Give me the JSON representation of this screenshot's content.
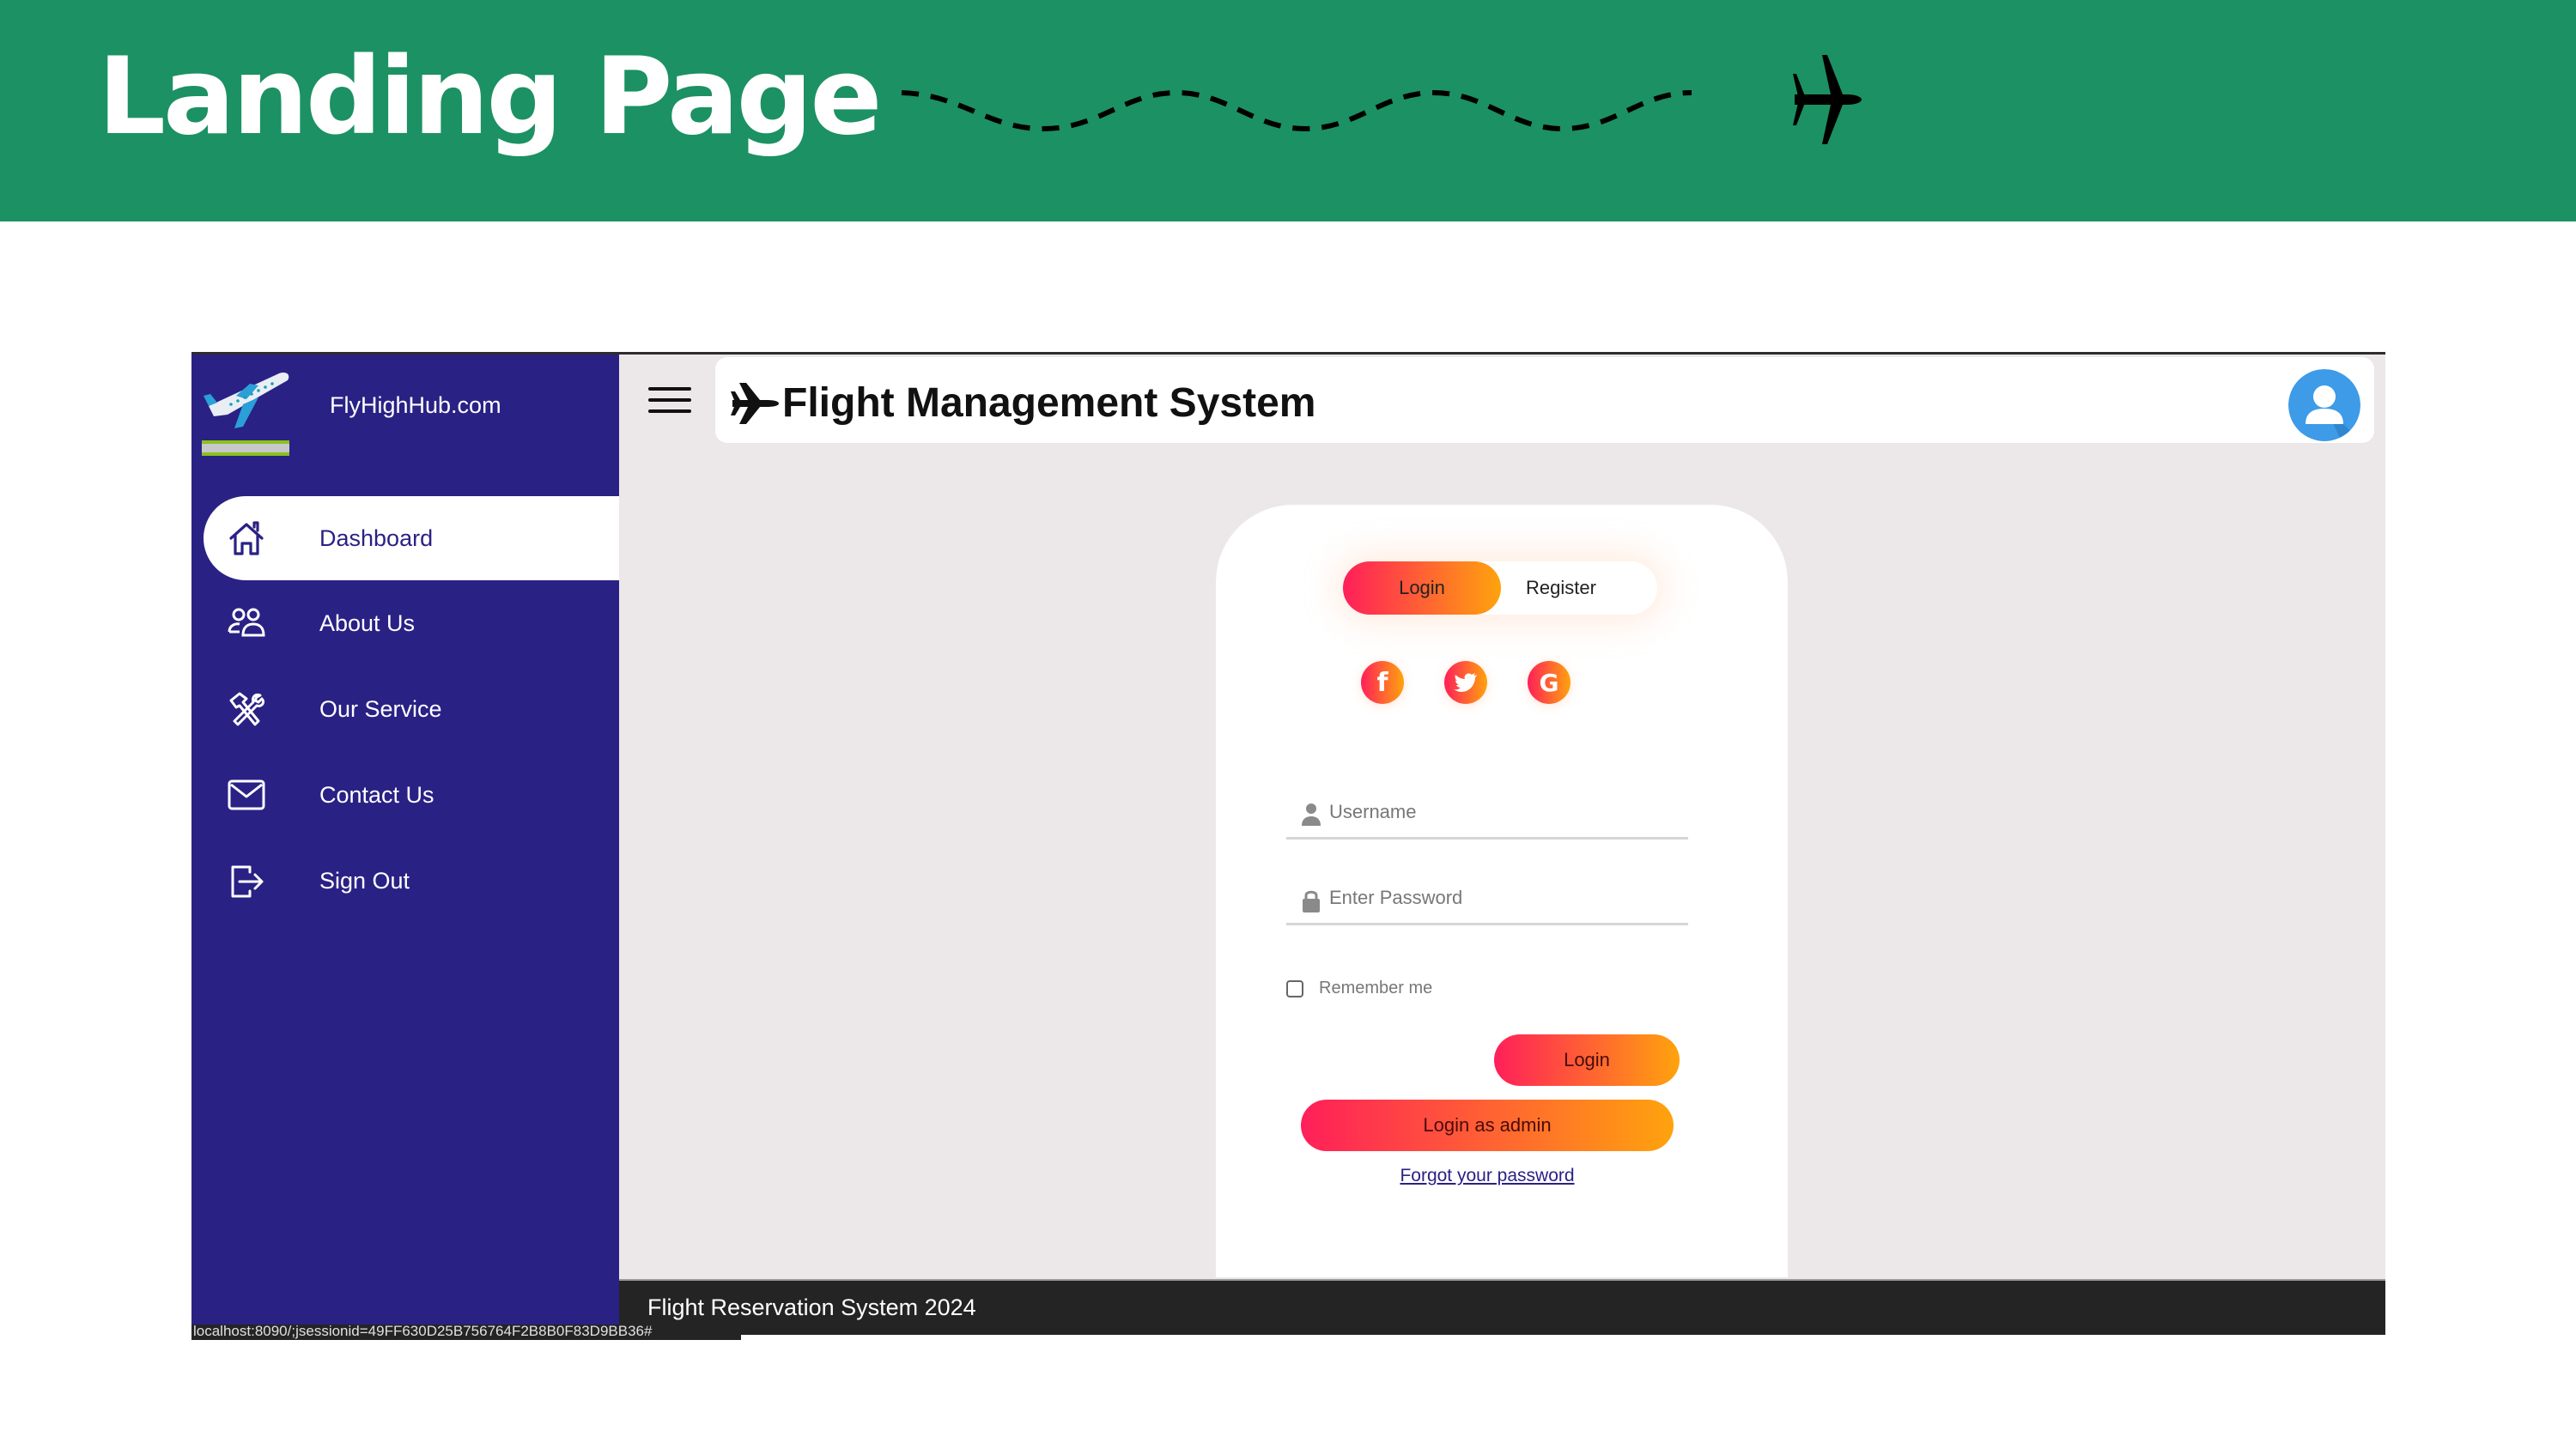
{
  "slide": {
    "title": "Landing Page",
    "colors": {
      "banner": "#1c9163"
    }
  },
  "app": {
    "brand": {
      "name": "FlyHighHub.com",
      "logo_icon": "airplane-takeoff-icon"
    },
    "title": "Flight Management System",
    "title_icon": "airplane-icon",
    "colors": {
      "sidebar": "#2a2185",
      "gradient_start": "#ff1f5a",
      "gradient_end": "#ffa30d",
      "footer": "#242424"
    },
    "sidebar": {
      "items": [
        {
          "label": "Dashboard",
          "icon": "home-icon",
          "active": true
        },
        {
          "label": "About Us",
          "icon": "users-icon",
          "active": false
        },
        {
          "label": "Our Service",
          "icon": "tools-icon",
          "active": false
        },
        {
          "label": "Contact Us",
          "icon": "mail-icon",
          "active": false
        },
        {
          "label": "Sign Out",
          "icon": "sign-out-icon",
          "active": false
        }
      ]
    },
    "auth": {
      "tabs": {
        "login": "Login",
        "register": "Register",
        "active": "Login"
      },
      "socials": [
        {
          "name": "facebook",
          "glyph": "f"
        },
        {
          "name": "twitter",
          "glyph": "twitter-bird"
        },
        {
          "name": "google",
          "glyph": "G"
        }
      ],
      "username": {
        "value": "",
        "placeholder": "Username"
      },
      "password": {
        "value": "",
        "placeholder": "Enter Password"
      },
      "remember_label": "Remember me",
      "remember_checked": false,
      "login_button": "Login",
      "admin_button": "Login as admin",
      "forgot_link": "Forgot your password"
    },
    "footer": {
      "text": "Flight Reservation System 2024"
    },
    "status_url": "localhost:8090/;jsessionid=49FF630D25B756764F2B8B0F83D9BB36#"
  }
}
